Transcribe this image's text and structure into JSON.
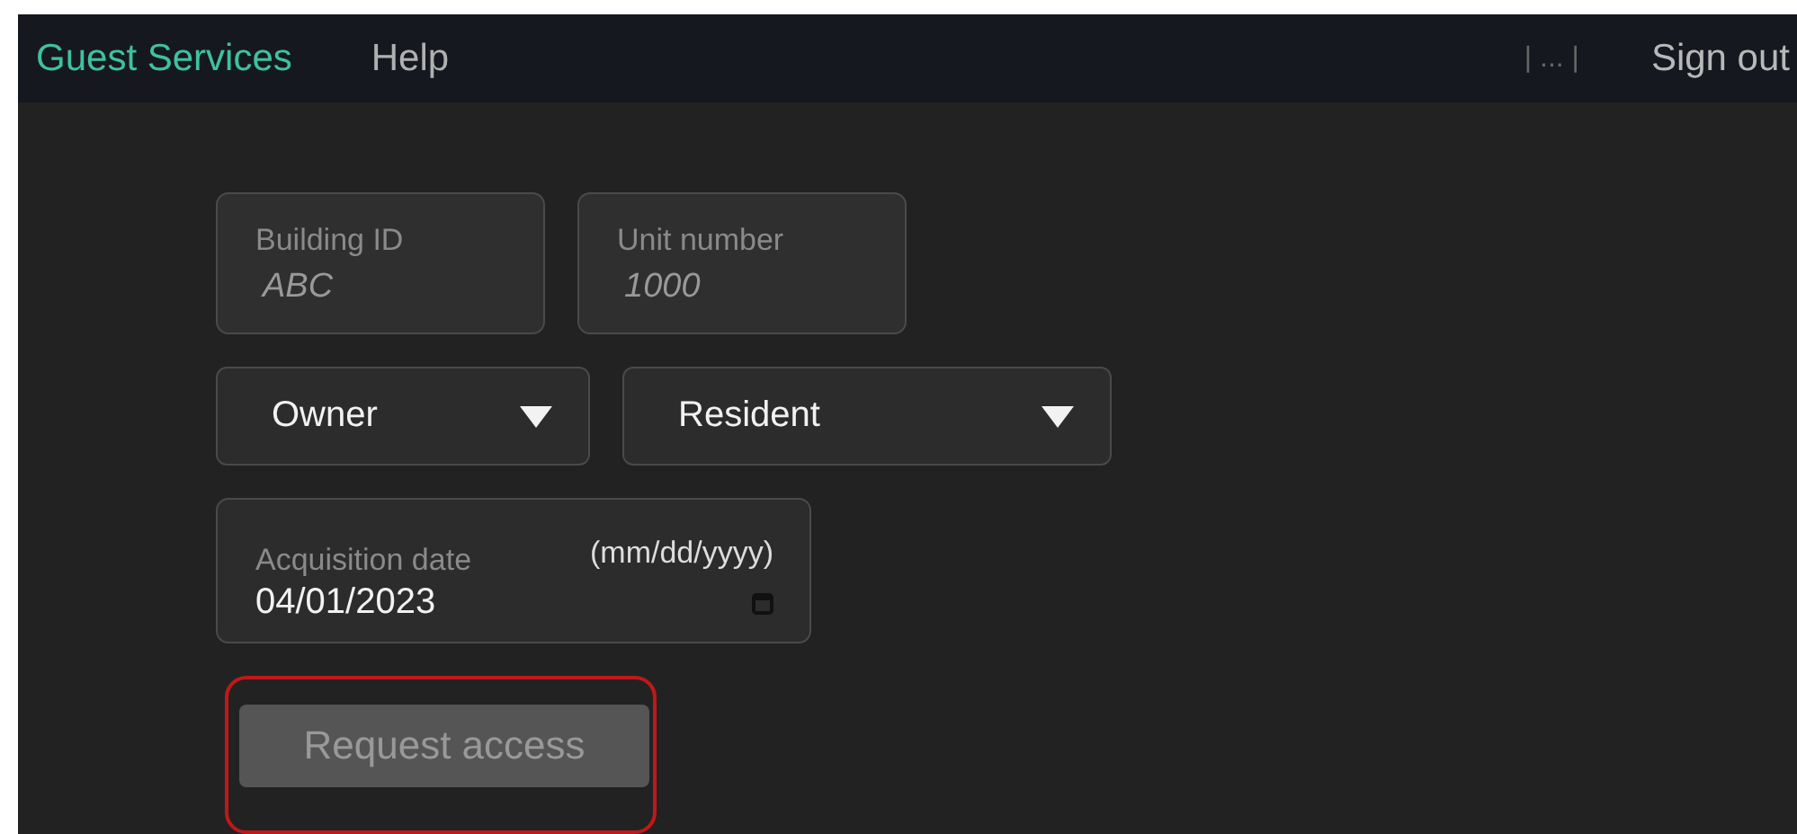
{
  "nav": {
    "brand": "Guest Services",
    "links": [
      "Help"
    ],
    "separator": "| ... |",
    "sign_out": "Sign out"
  },
  "fields": [
    {
      "label": "Building ID",
      "placeholder": "ABC"
    },
    {
      "label": "Unit number",
      "placeholder": "1000"
    }
  ],
  "selects": [
    {
      "value": "Owner"
    },
    {
      "value": "Resident"
    }
  ],
  "date_field": {
    "label": "Acquisition date",
    "hint": "(mm/dd/yyyy)",
    "value": "04/01/2023"
  },
  "submit": {
    "label": "Request access",
    "disabled": true,
    "highlighted": true
  }
}
